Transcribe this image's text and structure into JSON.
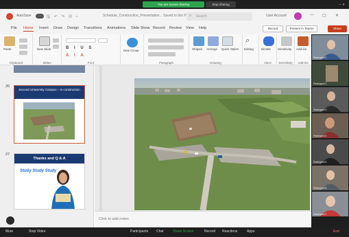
{
  "share": {
    "notice": "You are screen sharing",
    "stop_label": "Stop sharing"
  },
  "titlebar": {
    "autosave": "AutoSave",
    "filename": "Schedule_Construction_Presentation...  Saved to this PC",
    "search_placeholder": "Search",
    "user": "User Account"
  },
  "tabs": [
    "File",
    "Home",
    "Insert",
    "Draw",
    "Design",
    "Transitions",
    "Animations",
    "Slide Show",
    "Record",
    "Review",
    "View",
    "Help"
  ],
  "actions": {
    "record": "Record",
    "present": "Present in Teams",
    "share": "Share"
  },
  "ribbon": {
    "paste": "Paste",
    "new_slide": "New Slide",
    "new_group": "New Group",
    "shapes": "Shapes",
    "arrange": "Arrange",
    "quick_styles": "Quick Styles",
    "editing": "Editing",
    "dictate": "Dictate",
    "sensitivity": "Sensitivity",
    "addins": "Add-ins",
    "groups": [
      "Clipboard",
      "Slides",
      "Font",
      "Paragraph",
      "Drawing",
      "Voice",
      "Sensitivity",
      "Add-ins"
    ]
  },
  "slides": [
    {
      "number": "26",
      "title": "Second Uniwersity Campus – in construction"
    },
    {
      "number": "27",
      "title": "Thanks and Q & A",
      "promo": "Study Study Study"
    }
  ],
  "notes_placeholder": "Click to add notes",
  "participants": [
    {
      "name": "Participant 1"
    },
    {
      "name": "Participant 2"
    },
    {
      "name": "Participant 3"
    },
    {
      "name": "Participant 4"
    },
    {
      "name": "Participant 5"
    },
    {
      "name": "Participant 6"
    },
    {
      "name": "Participant 7"
    }
  ],
  "taskbar": {
    "items": [
      "Mute",
      "Stop Video",
      "Participants",
      "Chat",
      "Share Screen",
      "Record",
      "Reactions",
      "Apps",
      "End"
    ]
  },
  "colors": {
    "accent": "#c43e1c",
    "slide_header": "#1c3a72",
    "share_green": "#2ea44f"
  }
}
